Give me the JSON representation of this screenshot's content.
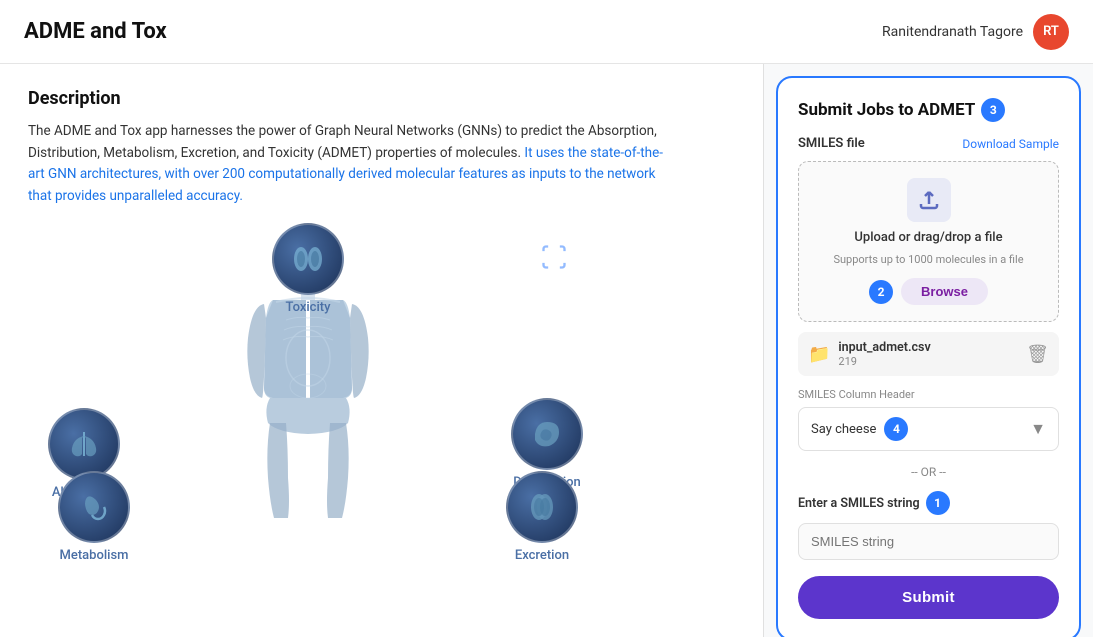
{
  "header": {
    "title": "ADME and Tox",
    "username": "Ranitendranath Tagore",
    "avatar_initials": "RT"
  },
  "left": {
    "description_title": "Description",
    "description_p1": "The ADME and Tox app harnesses the power of Graph Neural Networks (GNNs) to predict the Absorption, Distribution, Metabolism, Excretion, and Toxicity (ADMET) properties of molecules.",
    "description_highlight": "It uses the state-of-the-art GNN architectures, with over 200 computationally derived molecular features as inputs to the network that provides unparalleled accuracy.",
    "nodes": [
      {
        "id": "toxicity",
        "label": "Toxicity"
      },
      {
        "id": "absorption",
        "label": "Absorption"
      },
      {
        "id": "distribution",
        "label": "Distribution"
      },
      {
        "id": "metabolism",
        "label": "Metabolism"
      },
      {
        "id": "excretion",
        "label": "Excretion"
      }
    ]
  },
  "right": {
    "panel_title": "Submit Jobs to ADMET",
    "step3_label": "3",
    "smiles_file_label": "SMILES file",
    "download_sample_label": "Download Sample",
    "upload_main_text": "Upload or drag/drop a file",
    "upload_sub_text": "Supports up to 1000 molecules in a file",
    "step2_label": "2",
    "browse_button_label": "Browse",
    "file_name": "input_admet.csv",
    "file_count": "219",
    "col_header_label": "SMILES Column Header",
    "smiles_column_value": "Say cheese",
    "step4_label": "4",
    "or_divider_text": "-- OR --",
    "enter_smiles_label": "Enter a SMILES string",
    "step1_label": "1",
    "smiles_input_placeholder": "SMILES string",
    "submit_button_label": "Submit"
  }
}
